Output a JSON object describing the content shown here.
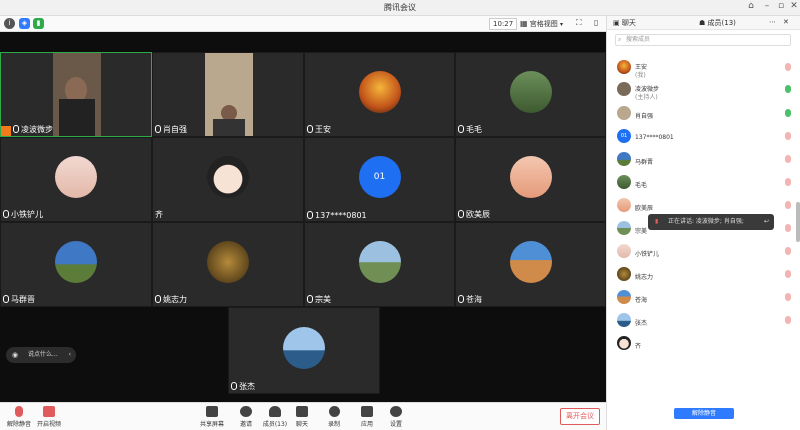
{
  "window": {
    "title": "腾讯会议"
  },
  "toolbar": {
    "time": "10:27",
    "view_label": "宫格视图"
  },
  "stage": {
    "tiles": [
      {
        "name": "凌波微步"
      },
      {
        "name": "肖自强"
      },
      {
        "name": "王安"
      },
      {
        "name": "毛毛"
      },
      {
        "name": "小铁铲儿"
      },
      {
        "name": "齐"
      },
      {
        "name": "137****0801",
        "avatar_text": "01"
      },
      {
        "name": "欧美辰"
      },
      {
        "name": "马群晋"
      },
      {
        "name": "姚志力"
      },
      {
        "name": "宗美"
      },
      {
        "name": "苍海"
      },
      {
        "name": "张杰"
      }
    ],
    "chat_hint": "说点什么..."
  },
  "bottombar": {
    "unmute": "解除静音",
    "start_video": "开启视频",
    "share": "共享屏幕",
    "invite": "邀请",
    "members": "成员(13)",
    "chat": "聊天",
    "record": "录制",
    "apps": "应用",
    "settings": "设置",
    "leave": "离开会议"
  },
  "panel": {
    "tab_chat": "聊天",
    "tab_members": "成员(13)",
    "search_placeholder": "搜索成员",
    "members": [
      {
        "name": "王安",
        "role": "(我)"
      },
      {
        "name": "凌波微步",
        "role": "(主持人)"
      },
      {
        "name": "肖自强",
        "role": ""
      },
      {
        "name": "137****0801",
        "role": "",
        "avatar_text": "01"
      },
      {
        "name": "马群晋",
        "role": ""
      },
      {
        "name": "毛毛",
        "role": ""
      },
      {
        "name": "欧美辰",
        "role": ""
      },
      {
        "name": "宗美",
        "role": ""
      },
      {
        "name": "小铁铲儿",
        "role": ""
      },
      {
        "name": "姚志力",
        "role": ""
      },
      {
        "name": "苍海",
        "role": ""
      },
      {
        "name": "张杰",
        "role": ""
      },
      {
        "name": "齐",
        "role": ""
      }
    ],
    "unmute_all": "解除静音",
    "speaking_toast": "正在讲话: 凌波微步; 肖自强;"
  },
  "colors": {
    "accent": "#2f7bff",
    "active_border": "#2eaa4a",
    "leave_red": "#e05b5b",
    "host_orange": "#f07a1c"
  }
}
